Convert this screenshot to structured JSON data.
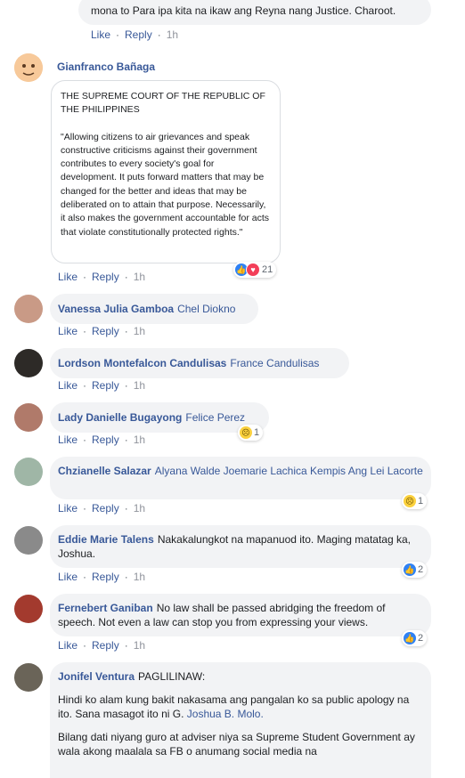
{
  "colors": {
    "link": "#385898",
    "bubble": "#f2f3f5",
    "meta": "#606770"
  },
  "top_comment": {
    "text": "mona to Para ipa kita na ikaw ang Reyna nang Justice. Charoot.",
    "like": "Like",
    "reply": "Reply",
    "time": "1h"
  },
  "gianfranco": {
    "author": "Gianfranco Bañaga",
    "quote_title": "THE SUPREME COURT OF THE REPUBLIC OF THE PHILIPPINES",
    "quote_body": "\"Allowing citizens to air grievances and speak constructive criticisms against their government contributes to every society's goal for development. It puts forward matters that may be changed for the better and ideas that may be deliberated on to attain that purpose. Necessarily, it also makes the government accountable for acts that violate constitutionally protected rights.\"",
    "reactions": "21",
    "like": "Like",
    "reply": "Reply",
    "time": "1h"
  },
  "vanessa": {
    "author": "Vanessa Julia Gamboa",
    "tag": "Chel Diokno",
    "like": "Like",
    "reply": "Reply",
    "time": "1h"
  },
  "lordson": {
    "author": "Lordson Montefalcon Candulisas",
    "tag": "France Candulisas",
    "like": "Like",
    "reply": "Reply",
    "time": "1h"
  },
  "lady": {
    "author": "Lady Danielle Bugayong",
    "tag": "Felice Perez",
    "reactions": "1",
    "like": "Like",
    "reply": "Reply",
    "time": "1h"
  },
  "chzianelle": {
    "author": "Chzianelle Salazar",
    "tag": "Alyana Walde Joemarie Lachica Kempis Ang Lei Lacorte",
    "reactions": "1",
    "like": "Like",
    "reply": "Reply",
    "time": "1h"
  },
  "eddie": {
    "author": "Eddie Marie Talens",
    "text": "Nakakalungkot na mapanuod ito. Maging matatag ka, Joshua.",
    "reactions": "2",
    "like": "Like",
    "reply": "Reply",
    "time": "1h"
  },
  "fernebert": {
    "author": "Fernebert Ganiban",
    "text": "No law shall be passed abridging the freedom of speech. Not even a law can stop you from expressing your views.",
    "reactions": "2",
    "like": "Like",
    "reply": "Reply",
    "time": "1h"
  },
  "jonifel": {
    "author": "Jonifel Ventura",
    "text1": "PAGLILINAW:",
    "text2": "Hindi ko alam kung bakit nakasama ang pangalan ko sa public apology na ito. Sana masagot ito ni G.",
    "tag": "Joshua B. Molo.",
    "text3": "Bilang dati niyang guro at adviser niya sa Supreme Student Government ay wala akong maalala sa FB o anumang social media na"
  }
}
